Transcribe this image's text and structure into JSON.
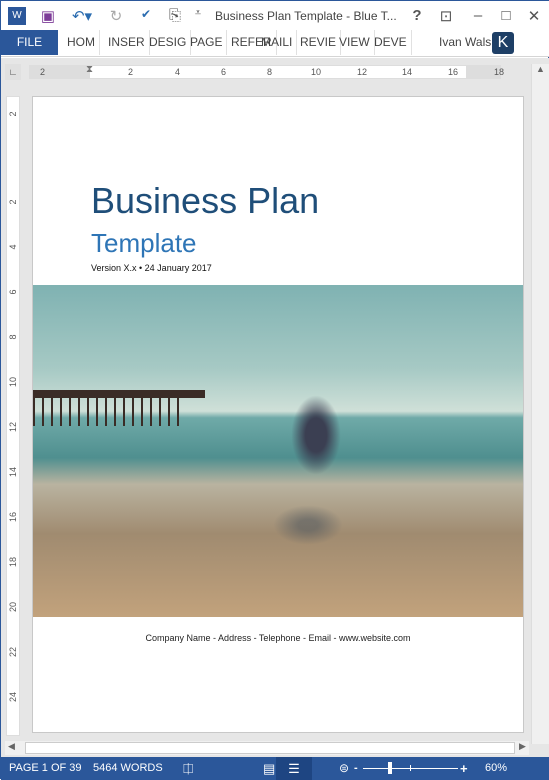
{
  "titlebar": {
    "title": "Business Plan Template - Blue T...",
    "help": "?",
    "icons": [
      "word-icon",
      "save-icon",
      "undo-icon",
      "redo-icon",
      "spelling-icon",
      "touch-mode-icon",
      "customize-icon"
    ]
  },
  "ribbon": {
    "file": "FILE",
    "tabs": [
      "HOM",
      "INSER",
      "DESIG",
      "PAGE",
      "REFER",
      "MAILI",
      "REVIE",
      "VIEW",
      "DEVE"
    ],
    "user": "Ivan Walsh",
    "avatar": "K"
  },
  "ruler": {
    "h": [
      "2",
      "2",
      "4",
      "6",
      "8",
      "10",
      "12",
      "14",
      "16",
      "18"
    ],
    "v": [
      "2",
      "2",
      "4",
      "6",
      "8",
      "10",
      "12",
      "14",
      "16",
      "18",
      "20",
      "22",
      "24"
    ]
  },
  "document": {
    "title": "Business Plan",
    "subtitle": "Template",
    "version": "Version X.x • 24 January 2017",
    "footer": "Company Name - Address - Telephone - Email - www.website.com"
  },
  "status": {
    "page": "PAGE 1 OF 39",
    "words": "5464 WORDS",
    "zoom": "60%",
    "zoom_minus": "-",
    "zoom_plus": "+"
  },
  "colors": {
    "accent": "#2b579a",
    "title": "#1f4e79",
    "subtitle": "#2e75b6"
  }
}
